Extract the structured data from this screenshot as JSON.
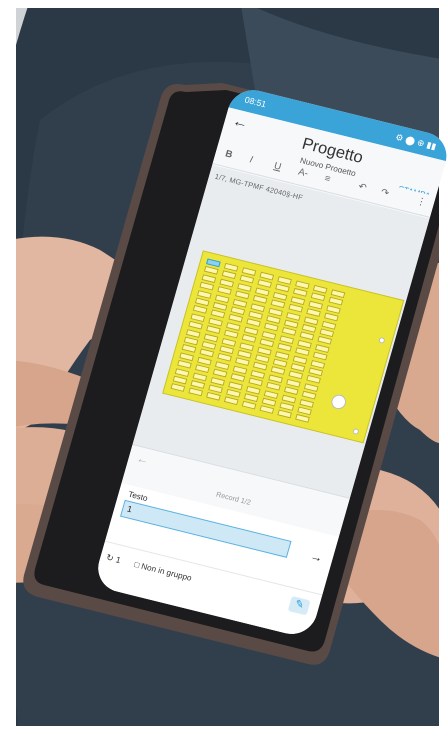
{
  "status_bar": {
    "time": "08:51",
    "right_icons": "⚙ ⬤ ⊕ ▮▮"
  },
  "header": {
    "back_icon": "arrow-left-icon",
    "title": "Progetto",
    "subtitle": "Nuovo Progetto",
    "action": "STAMPA"
  },
  "toolbar": {
    "bold": "B",
    "italic": "I",
    "underline": "U",
    "font_size": "A-",
    "align": "≡",
    "undo": "↶",
    "redo": "↷",
    "more": "⋮"
  },
  "document": {
    "label": "1/7, MG-TPMF 42040§-HF"
  },
  "navigator": {
    "record": "Record 1/2",
    "prev_icon": "arrow-left-icon"
  },
  "field": {
    "label": "Testo",
    "value": "1",
    "next_icon": "arrow-right-icon"
  },
  "bottom": {
    "counter": "1",
    "group": "Non in gruppo",
    "edit_icon": "pencil-icon"
  },
  "colors": {
    "accent": "#3aa3d8",
    "board": "#ece53a"
  }
}
